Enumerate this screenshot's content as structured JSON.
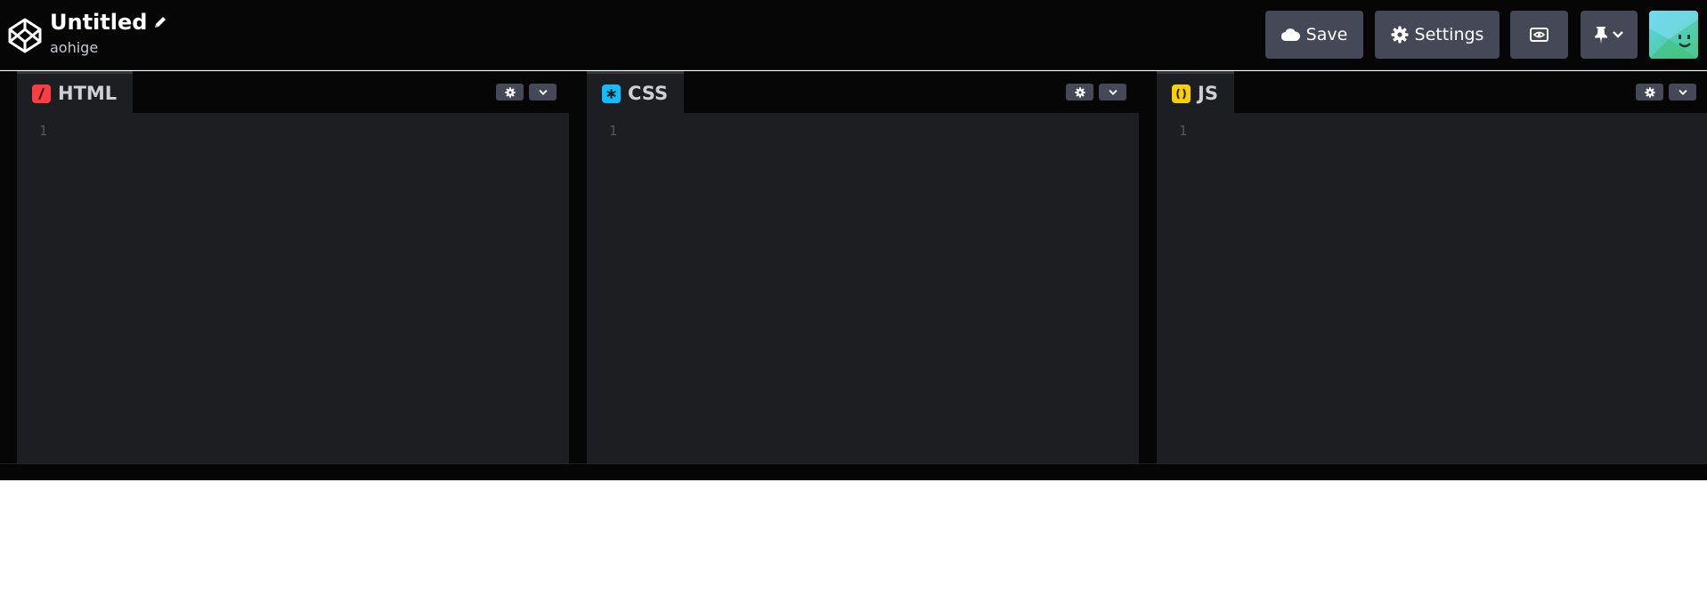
{
  "header": {
    "title": "Untitled",
    "username": "aohige",
    "buttons": {
      "save_label": "Save",
      "settings_label": "Settings"
    }
  },
  "panes": [
    {
      "label": "HTML",
      "badge_color": "#ff3c41",
      "line_number": "1"
    },
    {
      "label": "CSS",
      "badge_color": "#0ebeff",
      "line_number": "1"
    },
    {
      "label": "JS",
      "badge_color": "#fcd000",
      "line_number": "1"
    }
  ],
  "colors": {
    "background": "#060606",
    "editor": "#1d1e22",
    "button": "#444857"
  }
}
